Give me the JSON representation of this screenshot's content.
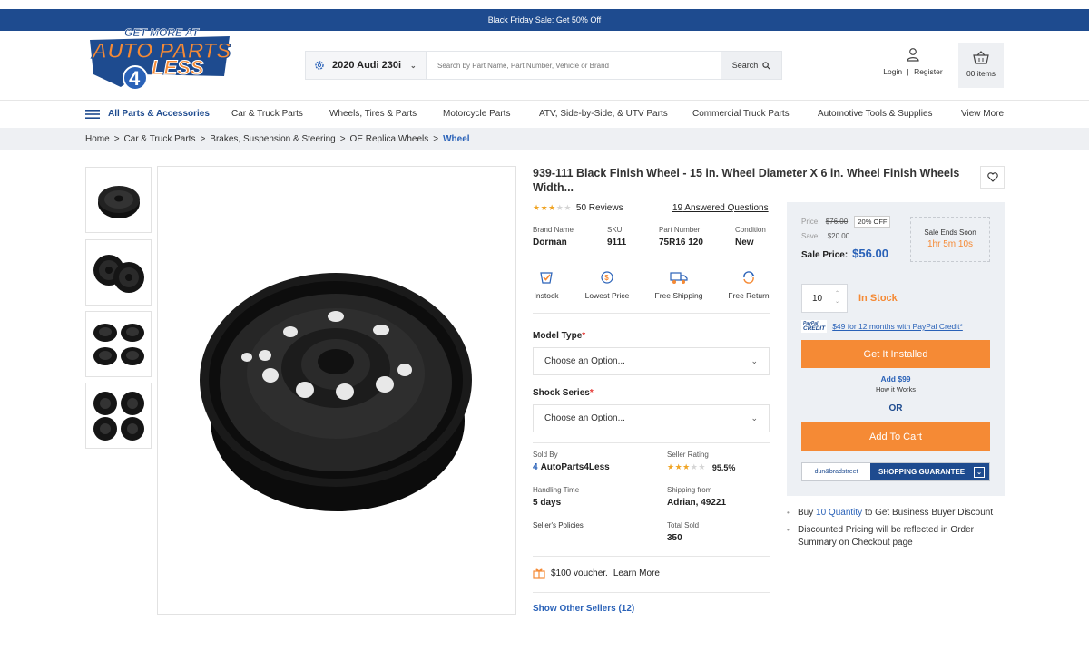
{
  "promo": {
    "text": "Black Friday Sale: Get 50% Off"
  },
  "logo": {
    "top": "GET MORE AT",
    "line1": "AUTO PARTS",
    "num": "4",
    "line2": "LESS"
  },
  "search": {
    "vehicle": "2020  Audi 230i",
    "placeholder": "Search by Part Name, Part Number, Vehicle or Brand",
    "button": "Search"
  },
  "account": {
    "login": "Login",
    "sep": "|",
    "register": "Register"
  },
  "cart": {
    "items": "00 items"
  },
  "nav": {
    "all": "All Parts & Accessories",
    "items": [
      "Car & Truck Parts",
      "Wheels, Tires & Parts",
      "Motorcycle Parts",
      "ATV, Side-by-Side, & UTV Parts",
      "Commercial Truck Parts",
      "Automotive Tools & Supplies",
      "View More"
    ]
  },
  "breadcrumb": {
    "items": [
      "Home",
      "Car & Truck Parts",
      "Brakes, Suspension & Steering",
      "OE Replica Wheels"
    ],
    "current": "Wheel",
    "sep": ">"
  },
  "product": {
    "title": "939-111 Black Finish Wheel - 15 in. Wheel Diameter X 6 in. Wheel Finish Wheels Width...",
    "rating": 3,
    "reviews": "50 Reviews",
    "qa_count": "19",
    "qa_label": " Answered Questions",
    "specs": [
      {
        "label": "Brand Name",
        "value": "Dorman"
      },
      {
        "label": "SKU",
        "value": "9111"
      },
      {
        "label": "Part Number",
        "value": "75R16 120"
      },
      {
        "label": "Condition",
        "value": "New"
      }
    ],
    "badges": [
      "Instock",
      "Lowest Price",
      "Free Shipping",
      "Free Return"
    ],
    "model_type_label": "Model Type",
    "shock_series_label": "Shock Series",
    "req_mark": "*",
    "select_placeholder": "Choose an Option...",
    "sold_by_label": "Sold By",
    "sold_by": "AutoParts4Less",
    "seller_rating_label": "Seller Rating",
    "seller_rating_value": "95.5%",
    "seller_stars": 3,
    "handling_label": "Handling Time",
    "handling": "5 days",
    "shipping_label": "Shipping from",
    "shipping_from": "Adrian, 49221",
    "policies": "Seller's Policies",
    "total_sold_label": "Total Sold",
    "total_sold": "350",
    "voucher": "$100 voucher.",
    "learn_more": "Learn More",
    "other_sellers": "Show Other Sellers (12)"
  },
  "pricing": {
    "price_label": "Price:",
    "price": "$76.00",
    "discount": "20% OFF",
    "save_label": "Save:",
    "save": "$20.00",
    "sale_label": "Sale Price:",
    "sale_price": "$56.00",
    "ends_label": "Sale Ends Soon",
    "ends_time": "1hr 5m 10s",
    "qty": "10",
    "stock": "In Stock",
    "paypal_top": "PayPal",
    "paypal_bottom": "CREDIT",
    "paypal": "$49 for 12 months with PayPal Credit*",
    "install_btn": "Get It Installed",
    "add_price": "Add $99",
    "how": "How it Works",
    "or": "OR",
    "cart_btn": "Add To Cart",
    "dnb": "dun&bradstreet",
    "guarantee": "SHOPPING GUARANTEE"
  },
  "notes": {
    "n1_pre": "Buy ",
    "n1_link": "10 Quantity",
    "n1_post": " to Get Business Buyer Discount",
    "n2": "Discounted Pricing will be reflected in Order Summary on Checkout page"
  },
  "colors": {
    "brand_blue": "#1e4b8f",
    "accent_orange": "#f58a35",
    "link_blue": "#2a62b8",
    "star": "#f0a526"
  }
}
